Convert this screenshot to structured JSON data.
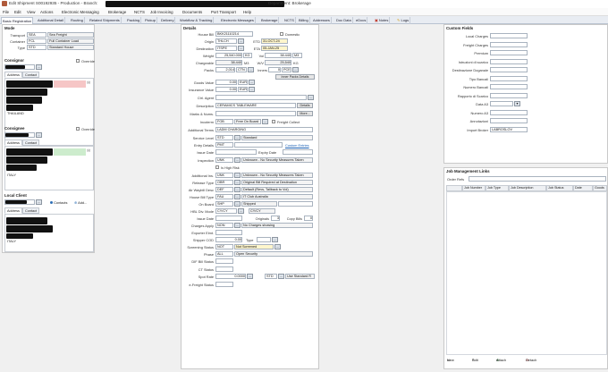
{
  "window": {
    "title_prefix": "Edit Shipment S00192935 - Production - Branch:",
    "title_suffix": "Department: Brokerage"
  },
  "menu": [
    "File",
    "Edit",
    "View",
    "Actions",
    "Electronic Messaging",
    "Brokerage",
    "NCTS",
    "Job Invoicing",
    "Documents",
    "Port Transport",
    "Help"
  ],
  "tabs": [
    {
      "label": "Basic Registration",
      "active": true
    },
    {
      "label": "Additional Detail"
    },
    {
      "label": "Routing"
    },
    {
      "label": "Related Shipments"
    },
    {
      "label": "Packing"
    },
    {
      "label": "Pickup"
    },
    {
      "label": "Delivery"
    },
    {
      "label": "Workflow & Tracking"
    },
    {
      "label": "Electronic Messages"
    },
    {
      "label": "Brokerage"
    },
    {
      "label": "NCTS"
    },
    {
      "label": "Billing"
    },
    {
      "label": "Addresses"
    },
    {
      "label": "Doc Data"
    },
    {
      "label": "eDocs"
    },
    {
      "label": "Notes"
    },
    {
      "label": "Logs"
    }
  ],
  "mode": {
    "title": "Mode",
    "transport_label": "Transport",
    "transport_code": "SEA",
    "transport_desc": "Sea Freight",
    "container_label": "Container",
    "container_code": "FCL",
    "container_desc": "Full Container Load",
    "type_label": "Type",
    "type_code": "STD",
    "type_desc": "Standard House"
  },
  "consignor": {
    "title": "Consignor",
    "override_label": "Override",
    "tab_address": "Address",
    "tab_contact": "Contact",
    "country": "THAILAND"
  },
  "consignee": {
    "title": "Consignee",
    "override_label": "Override",
    "tab_address": "Address",
    "tab_contact": "Contact",
    "country": "ITALY"
  },
  "local_client": {
    "title": "Local Client",
    "contacts_label": "Contacts",
    "add_label": "Add...",
    "tab_address": "Address",
    "tab_contact": "Contact",
    "country": "ITALY"
  },
  "details": {
    "title": "Details",
    "house_bill_label": "House Bill",
    "house_bill": "BKK21110214",
    "domestic_label": "Domestic",
    "origin_label": "Origin",
    "origin": "THLCH",
    "etd_label": "ETD",
    "etd": "31-OCT-24",
    "destination_label": "Destination",
    "destination": "ITSPE",
    "eta_label": "ETA",
    "eta": "05-JAN-25",
    "weight_label": "Weight",
    "weight": "25,540.000",
    "weight_unit": "KG",
    "vol_label": "Vol",
    "vol": "38.440",
    "vol_unit": "M3",
    "chargeable_label": "Chargeable",
    "chargeable": "38.440",
    "chargeable_unit": "M3",
    "wv_label": "W/V",
    "wv": "25,540",
    "wv_unit": "KG",
    "packs_label": "Packs",
    "packs": "2,014",
    "packs_unit": "CTN",
    "inners_label": "Inners",
    "inners": "0",
    "inners_unit": "PCE",
    "inner_packs_button": "Inner Packs Details",
    "goods_value_label": "Goods Value",
    "goods_value": "0.00",
    "goods_currency": "EUR",
    "insurance_label": "Insurance Value",
    "insurance_value": "0.00",
    "insurance_currency": "EUR",
    "ctrl_agent_label": "Ctrl. Agent",
    "description_label": "Description",
    "description": "CERAMICS TABLEWARE",
    "details_button": "Details",
    "marks_label": "Marks & Nums.",
    "more_button": "More...",
    "incoterm_label": "Incoterm",
    "incoterm": "FOB",
    "incoterm_desc": "Free On Board",
    "freight_label": "Freight Collect",
    "additional_terms_label": "Additional Terms",
    "additional_terms": "LADM CHARGING",
    "service_level_label": "Service Level",
    "service_level": "STD",
    "service_level_desc": "Standard",
    "entry_details_label": "Entry Details",
    "entry_details": "PMT",
    "custom_entries_link": "Custom Entries",
    "issue_date_label": "Issue Date",
    "expiry_date_label": "Expiry Date",
    "inspection_label": "Inspection",
    "inspection": "UNK",
    "inspection_desc": "Unknown - No Security Measures Taken",
    "high_risk_label": "Is High Risk",
    "additional_ins_label": "Additional Ins.",
    "additional_ins": "UNK",
    "additional_ins_desc": "Unknown - No Security Measures Taken",
    "release_type_label": "Release Type",
    "release_type": "OBR",
    "release_type_desc": "Original Bill Required at Destination",
    "air_wb_label": "Air Waybill Desc",
    "air_wb": "DEF",
    "air_wb_desc": "Default (Revs, Tallback to Vol)",
    "house_bill_type_label": "House Bill Type",
    "house_bill_type": "FAU",
    "house_bill_type_desc": "IT Club Australia",
    "on_board_label": "On Board",
    "on_board": "SHP",
    "on_board_desc": "Shipped",
    "hbl_mode_label": "HBL Div. Mode",
    "hbl_mode": "CY/CY",
    "hbl_mode_desc": "CY/CY",
    "issue_date2_label": "Issue Date",
    "originals_label": "Originals",
    "originals": "3",
    "copy_bills_label": "Copy Bills",
    "copy_bills": "0",
    "charges_apply_label": "Charges Apply",
    "charges_apply": "NON",
    "charges_apply_desc": "No Charges showing",
    "exporter_label": "Exporter Elmt.",
    "shipper_cod_label": "Shipper COD",
    "shipper_cod": "0.00",
    "type_label": "Type",
    "screening_label": "Screening Status",
    "screening": "NOT",
    "screening_desc": "Not Screened",
    "phase_label": "Phase",
    "phase": "ALL",
    "phase_desc": "Open Security",
    "dif_label": "DIF Bill Status",
    "ct_label": "CT Status",
    "spot_rate_label": "Spot Rate",
    "spot_rate": "0.0000",
    "spot_rate_type": "STD",
    "spot_rate_desc": "Use Standard R",
    "efreight_label": "e-Freight Status"
  },
  "custom_fields": {
    "title": "Custom Fields",
    "fields": [
      {
        "label": "Local Charges",
        "value": ""
      },
      {
        "label": "Freight Charges",
        "value": ""
      },
      {
        "label": "Premium",
        "value": ""
      },
      {
        "label": "Istruzioni di scarico",
        "value": ""
      },
      {
        "label": "Destinazione Doganale",
        "value": ""
      },
      {
        "label": "Tipo Bancali",
        "value": ""
      },
      {
        "label": "Numero Bancali",
        "value": ""
      },
      {
        "label": "Rapporto di Scarico",
        "value": ""
      },
      {
        "label": "Data A3",
        "value": ""
      },
      {
        "label": "Numero A3",
        "value": ""
      },
      {
        "label": "Annotazioni",
        "value": ""
      },
      {
        "label": "Import Broker",
        "value": "LABROSLOV"
      }
    ]
  },
  "job_links": {
    "title": "Job Management Links",
    "order_refs_label": "Order Refs",
    "columns": [
      "Job Number",
      "Job Type",
      "Job Description",
      "Job Status",
      "Date",
      "Goods"
    ],
    "toolbar": {
      "new": "New",
      "edit": "Edit",
      "attach": "Attach",
      "detach": "Detach"
    }
  }
}
